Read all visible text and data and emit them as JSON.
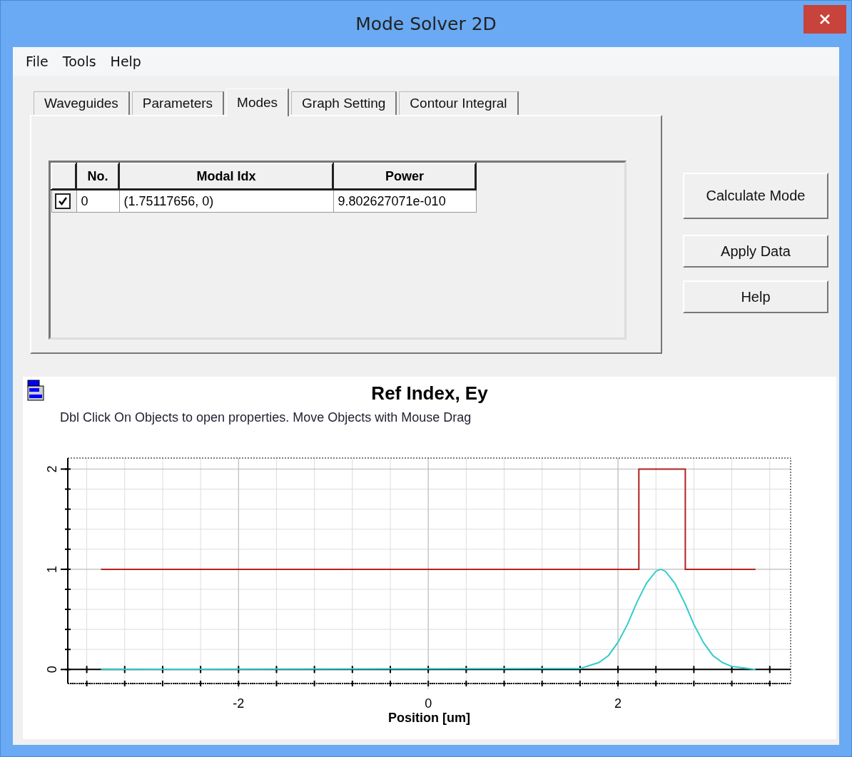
{
  "window": {
    "title": "Mode Solver 2D"
  },
  "menu": [
    "File",
    "Tools",
    "Help"
  ],
  "tabs": [
    {
      "label": "Waveguides",
      "selected": false
    },
    {
      "label": "Parameters",
      "selected": false
    },
    {
      "label": "Modes",
      "selected": true
    },
    {
      "label": "Graph Setting",
      "selected": false
    },
    {
      "label": "Contour Integral",
      "selected": false
    }
  ],
  "table": {
    "columns": [
      "No.",
      "Modal Idx",
      "Power"
    ],
    "rows": [
      {
        "checked": true,
        "cells": [
          "0",
          "(1.75117656, 0)",
          "9.802627071e-010"
        ]
      }
    ]
  },
  "buttons": [
    "Calculate Mode",
    "Apply Data",
    "Help"
  ],
  "graph": {
    "subtitle": "Dbl Click On Objects to open properties.  Move Objects with Mouse Drag",
    "chart_data": {
      "type": "line",
      "title": "Ref Index, Ey",
      "xlabel": "Position [um]",
      "x": [
        -3.45,
        1.6,
        1.8,
        1.9,
        2.0,
        2.1,
        2.2,
        2.22,
        2.22,
        2.3,
        2.4,
        2.45,
        2.5,
        2.6,
        2.7,
        2.71,
        2.71,
        2.8,
        2.9,
        3.0,
        3.1,
        3.2,
        3.45
      ],
      "series": [
        {
          "color": "#b22222",
          "values": [
            1,
            1,
            1,
            1,
            1,
            1,
            1,
            1,
            2,
            2,
            2,
            2,
            2,
            2,
            2,
            2,
            1,
            1,
            1,
            1,
            1,
            1,
            1
          ]
        },
        {
          "color": "#33cccc",
          "values": [
            0,
            0.01,
            0.07,
            0.14,
            0.27,
            0.45,
            0.67,
            0.71,
            0.71,
            0.86,
            0.98,
            1,
            0.98,
            0.86,
            0.67,
            0.65,
            0.65,
            0.45,
            0.27,
            0.14,
            0.07,
            0.03,
            0
          ]
        }
      ],
      "grid": true,
      "xlim": [
        -3.8,
        3.82
      ],
      "ylim": [
        -0.14,
        2.11
      ],
      "xticks": [
        -2,
        0,
        2
      ],
      "yticks": [
        0,
        1,
        2
      ]
    }
  }
}
